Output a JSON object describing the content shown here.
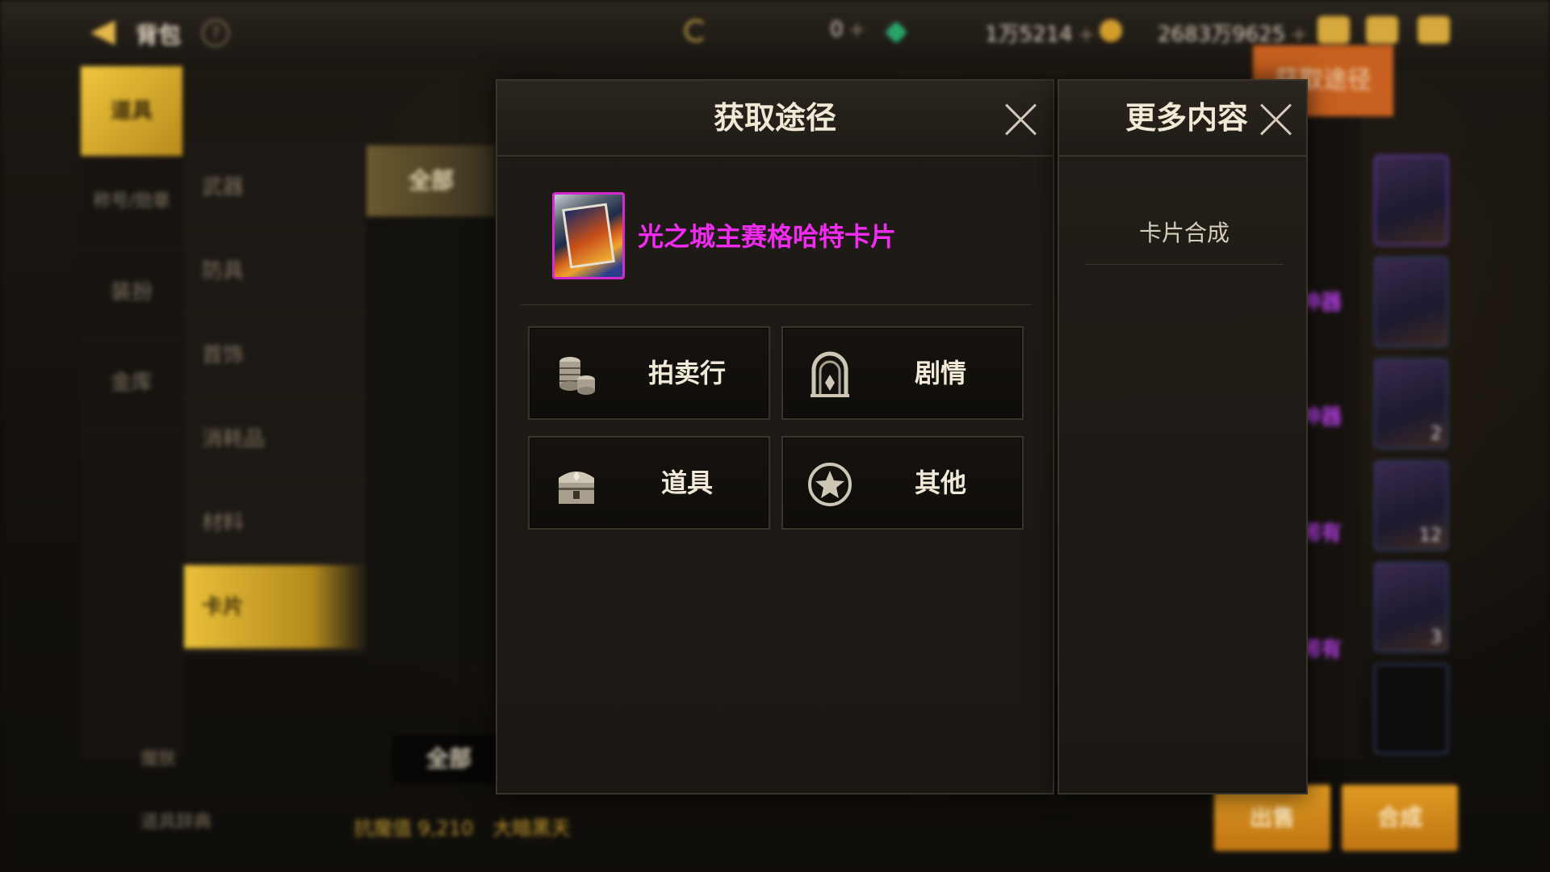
{
  "topbar": {
    "back_icon": "back-arrow-icon",
    "title": "背包",
    "help_label": "?",
    "currencies": [
      {
        "value": "0",
        "plus": "+"
      },
      {
        "value": "1万5214",
        "plus": "+"
      },
      {
        "value": "2683万9625",
        "plus": "+"
      }
    ]
  },
  "left_rail": {
    "items": [
      "道具",
      "称号/勋章",
      "装扮",
      "金库"
    ]
  },
  "categories": {
    "items": [
      "武器",
      "防具",
      "首饰",
      "消耗品",
      "材料",
      "卡片"
    ],
    "sub_filter": "全部"
  },
  "bottom_bar": {
    "filter_label": "全部",
    "left_item_1": "魔肤",
    "left_item_2": "道具辞典",
    "resist": "抗魔值 9,210",
    "zone": "大暗黑天"
  },
  "background_right": {
    "orange_tab": "获取途径",
    "purple_labels": [
      "神器",
      "神器",
      "稀有",
      "稀有"
    ],
    "card_counts": [
      "",
      "",
      "2",
      "12",
      "3",
      ""
    ],
    "sell_button": "出售",
    "combine_button": "合成"
  },
  "dialog": {
    "title": "获取途径",
    "item_name": "光之城主赛格哈特卡片",
    "sources": [
      {
        "label": "拍卖行",
        "icon": "coin-stack-icon"
      },
      {
        "label": "剧情",
        "icon": "gate-icon"
      },
      {
        "label": "道具",
        "icon": "treasure-chest-icon"
      },
      {
        "label": "其他",
        "icon": "star-circle-icon"
      }
    ]
  },
  "more_panel": {
    "title": "更多内容",
    "items": [
      "卡片合成"
    ]
  },
  "colors": {
    "item_name": "#f22bf0",
    "accent_gold": "#e9c03a",
    "panel_border": "#3a342a"
  }
}
